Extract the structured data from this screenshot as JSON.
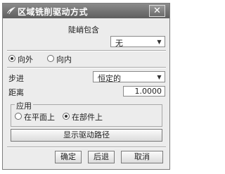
{
  "window": {
    "title": "区域铣削驱动方式"
  },
  "steep": {
    "heading": "陡峭包含",
    "dropdown_value": "无"
  },
  "direction": {
    "options": [
      {
        "label": "向外",
        "selected": true
      },
      {
        "label": "向内",
        "selected": false
      }
    ]
  },
  "stepover": {
    "label": "步进",
    "dropdown_value": "恒定的"
  },
  "distance": {
    "label": "距离",
    "value": "1.0000"
  },
  "apply": {
    "legend": "应用",
    "options": [
      {
        "label": "在平面上",
        "selected": false
      },
      {
        "label": "在部件上",
        "selected": true
      }
    ]
  },
  "show_path_button": "显示驱动路径",
  "footer": {
    "ok": "确定",
    "back": "后退",
    "cancel": "取消"
  },
  "icons": {
    "app": "ug-app-icon",
    "close": "close-icon",
    "dropdown": "chevron-down-icon"
  }
}
